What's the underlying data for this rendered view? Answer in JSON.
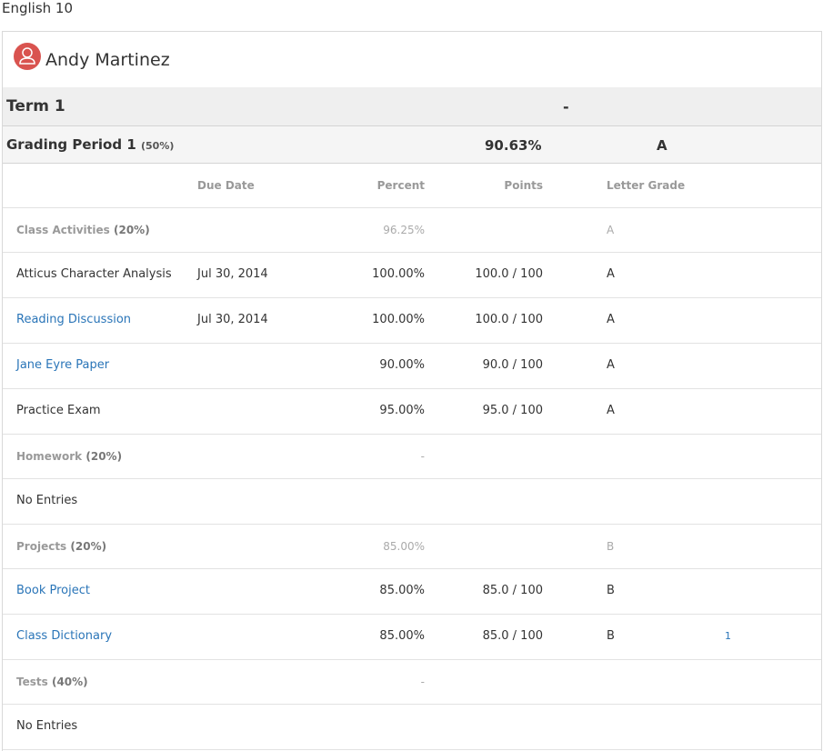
{
  "course": {
    "title": "English 10"
  },
  "student": {
    "name": "Andy Martinez"
  },
  "term": {
    "name": "Term 1",
    "value": "-"
  },
  "grading_period": {
    "name": "Grading Period 1",
    "weight": "(50%)",
    "percent": "90.63%",
    "letter": "A"
  },
  "columns": {
    "due_date": "Due Date",
    "percent": "Percent",
    "points": "Points",
    "letter_grade": "Letter Grade"
  },
  "categories": [
    {
      "name": "Class Activities",
      "weight": "(20%)",
      "percent": "96.25%",
      "letter": "A",
      "items": [
        {
          "name": "Atticus Character Analysis",
          "due": "Jul 30, 2014",
          "percent": "100.00%",
          "points": "100.0 / 100",
          "letter": "A",
          "link": false
        },
        {
          "name": "Reading Discussion",
          "due": "Jul 30, 2014",
          "percent": "100.00%",
          "points": "100.0 / 100",
          "letter": "A",
          "link": true
        },
        {
          "name": "Jane Eyre Paper",
          "due": "",
          "percent": "90.00%",
          "points": "90.0 / 100",
          "letter": "A",
          "link": true
        },
        {
          "name": "Practice Exam",
          "due": "",
          "percent": "95.00%",
          "points": "95.0 / 100",
          "letter": "A",
          "link": false
        }
      ]
    },
    {
      "name": "Homework",
      "weight": "(20%)",
      "percent": "-",
      "letter": "",
      "items": [
        {
          "name": "No Entries"
        }
      ]
    },
    {
      "name": "Projects",
      "weight": "(20%)",
      "percent": "85.00%",
      "letter": "B",
      "items": [
        {
          "name": "Book Project",
          "due": "",
          "percent": "85.00%",
          "points": "85.0 / 100",
          "letter": "B",
          "link": true
        },
        {
          "name": "Class Dictionary",
          "due": "",
          "percent": "85.00%",
          "points": "85.0 / 100",
          "letter": "B",
          "link": true,
          "comment_count": "1"
        }
      ]
    },
    {
      "name": "Tests",
      "weight": "(40%)",
      "percent": "-",
      "letter": "",
      "items": [
        {
          "name": "No Entries"
        }
      ]
    }
  ]
}
